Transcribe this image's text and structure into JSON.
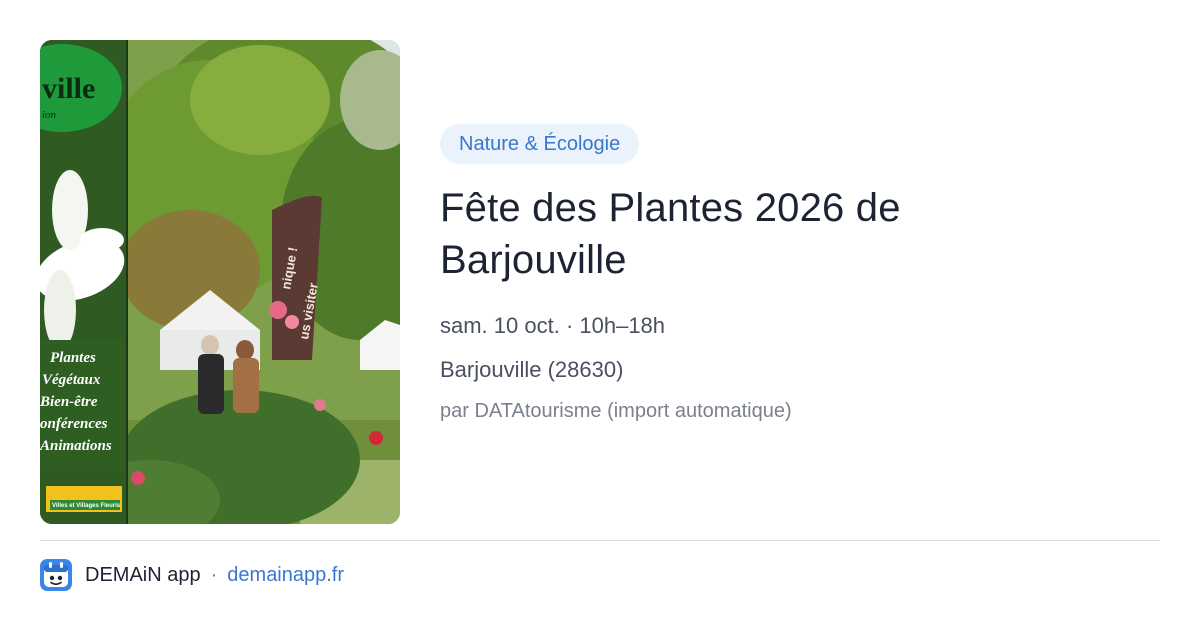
{
  "event": {
    "category": "Nature & Écologie",
    "title": "Fête des Plantes 2026 de Barjouville",
    "datetime": "sam. 10 oct. · 10h–18h",
    "location": "Barjouville (28630)",
    "source": "par DATAtourisme (import automatique)",
    "image": {
      "poster_title": "ville",
      "poster_subtitle": "ion",
      "poster_lines": [
        "Plantes",
        "Végétaux",
        "Bien-être",
        "onférences",
        "Animations"
      ],
      "poster_footer": "Villes et Villages Fleuris",
      "flag_text": [
        "nique !",
        "us visiter"
      ]
    }
  },
  "footer": {
    "app_name": "DEMAiN app",
    "separator": "·",
    "url": "demainapp.fr"
  }
}
